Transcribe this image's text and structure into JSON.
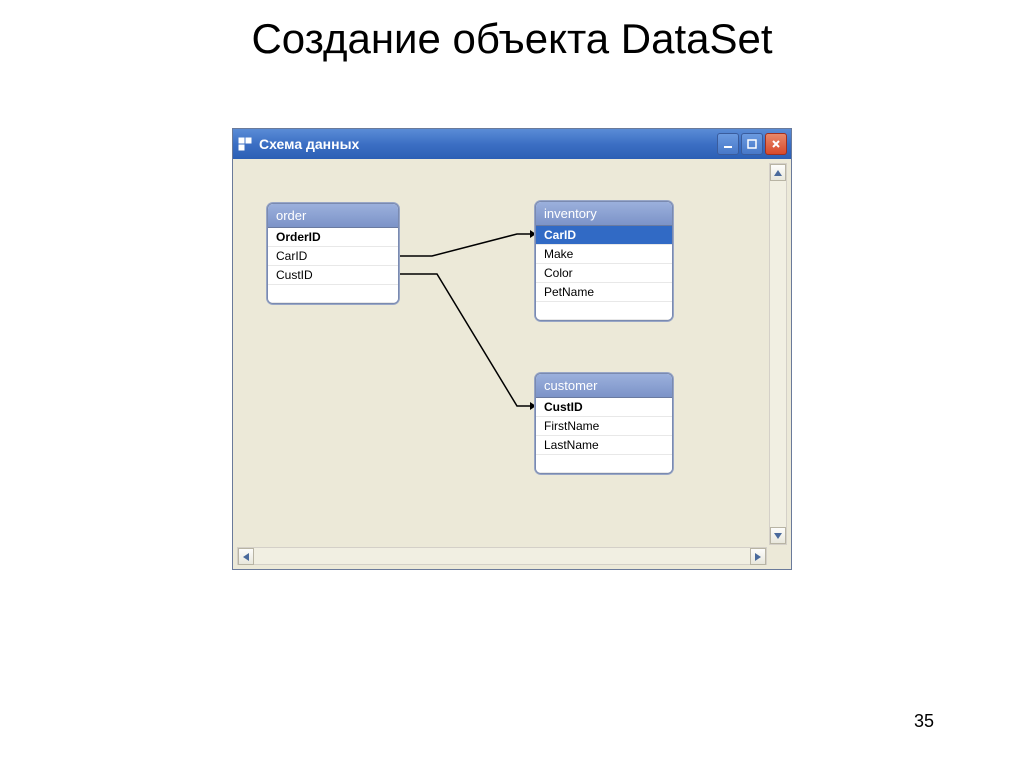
{
  "page": {
    "title": "Создание объекта DataSet",
    "number": "35"
  },
  "window": {
    "title": "Схема данных"
  },
  "entities": {
    "order": {
      "name": "order",
      "fields": [
        {
          "name": "OrderID",
          "primary": true,
          "selected": false
        },
        {
          "name": "CarID",
          "primary": false,
          "selected": false
        },
        {
          "name": "CustID",
          "primary": false,
          "selected": false
        }
      ]
    },
    "inventory": {
      "name": "inventory",
      "fields": [
        {
          "name": "CarID",
          "primary": true,
          "selected": true
        },
        {
          "name": "Make",
          "primary": false,
          "selected": false
        },
        {
          "name": "Color",
          "primary": false,
          "selected": false
        },
        {
          "name": "PetName",
          "primary": false,
          "selected": false
        }
      ]
    },
    "customer": {
      "name": "customer",
      "fields": [
        {
          "name": "CustID",
          "primary": true,
          "selected": false
        },
        {
          "name": "FirstName",
          "primary": false,
          "selected": false
        },
        {
          "name": "LastName",
          "primary": false,
          "selected": false
        }
      ]
    }
  },
  "relationships": [
    {
      "from": "order.CarID",
      "to": "inventory.CarID"
    },
    {
      "from": "order.CustID",
      "to": "customer.CustID"
    }
  ]
}
